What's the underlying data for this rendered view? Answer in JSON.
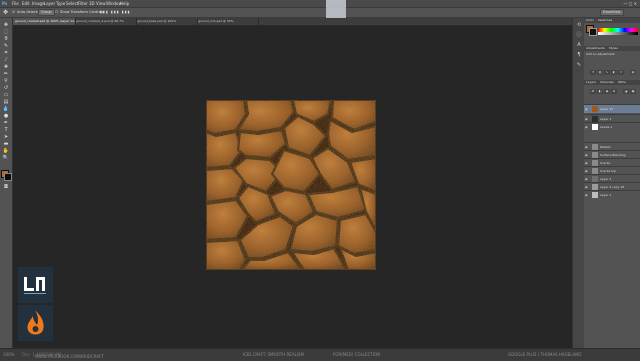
{
  "menu": {
    "items": [
      "File",
      "Edit",
      "Image",
      "Layer",
      "Type",
      "Select",
      "Filter",
      "3D",
      "View",
      "Window",
      "Help"
    ]
  },
  "options_bar": {
    "auto_select": "Auto-Select:",
    "layer_dropdown": "Group",
    "show_transform": "Show Transform Controls"
  },
  "tooltip": {
    "text": "Essentials"
  },
  "document_tabs": [
    "ground_cracked.psd @ 100% (Layer 12, RGB/8#)",
    "ground_cracked_2.psd @ 66.7%",
    "ground_base.psd @ 100%",
    "ground_mix.psd @ 50%"
  ],
  "panels": {
    "swatch_tabs": [
      "Color",
      "Swatches"
    ],
    "adjust_tabs": [
      "Adjustments",
      "Styles"
    ],
    "adjustments_title": "Add an adjustment",
    "layer_tabs": [
      "Layers",
      "Channels",
      "Paths"
    ],
    "layers": [
      {
        "name": "Layer 12",
        "selected": true
      },
      {
        "name": "Layer 1"
      },
      {
        "name": "Levels 1"
      },
      {
        "name": "Details"
      },
      {
        "name": "Surface Blending"
      },
      {
        "name": "Cracks"
      },
      {
        "name": "Cracks top"
      },
      {
        "name": "Layer 3"
      },
      {
        "name": "Layer 2 copy 18"
      },
      {
        "name": "Layer 1"
      }
    ]
  },
  "colors": {
    "foreground": "#b36a2a",
    "background": "#0d0d0d",
    "texture_base": "#9a5a22",
    "crack": "#1a0d05"
  },
  "statusbar": {
    "zoom": "100%",
    "doc": "Doc: 1.46M/196.8M",
    "left_link": "WWW.FACEBOOK.COM/KRIDCRAFT",
    "center": "K3D.CRAFT: SMOOTH REALISM",
    "center2": "FOR(MED) COLLECTION",
    "right": "GOOGLE PLUS | THOMAS HAGELAND"
  }
}
